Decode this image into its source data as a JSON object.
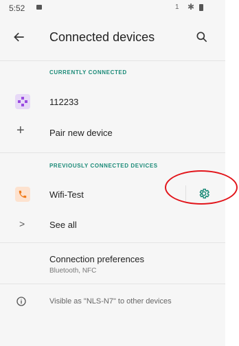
{
  "status_bar": {
    "time": "5:52",
    "sim": "1"
  },
  "app_bar": {
    "title": "Connected devices"
  },
  "currently_connected": {
    "header": "CURRENTLY CONNECTED",
    "device_name": "112233"
  },
  "pair_new": {
    "label": "Pair new device"
  },
  "previously_connected": {
    "header": "PREVIOUSLY CONNECTED DEVICES",
    "device_name": "Wifi-Test"
  },
  "see_all": {
    "label": "See all"
  },
  "connection_preferences": {
    "title": "Connection preferences",
    "subtitle": "Bluetooth, NFC"
  },
  "visibility": {
    "text": "Visible as \"NLS-N7\" to other devices"
  },
  "colors": {
    "accent": "#1a8a77",
    "gamepad_bg": "#e7d9f7",
    "phone_bg": "#fde2cf",
    "annotation": "#e2141a"
  },
  "icons": [
    "back-arrow-icon",
    "search-icon",
    "gamepad-icon",
    "plus-icon",
    "phone-icon",
    "gear-icon",
    "chevron-right-icon",
    "info-icon"
  ]
}
